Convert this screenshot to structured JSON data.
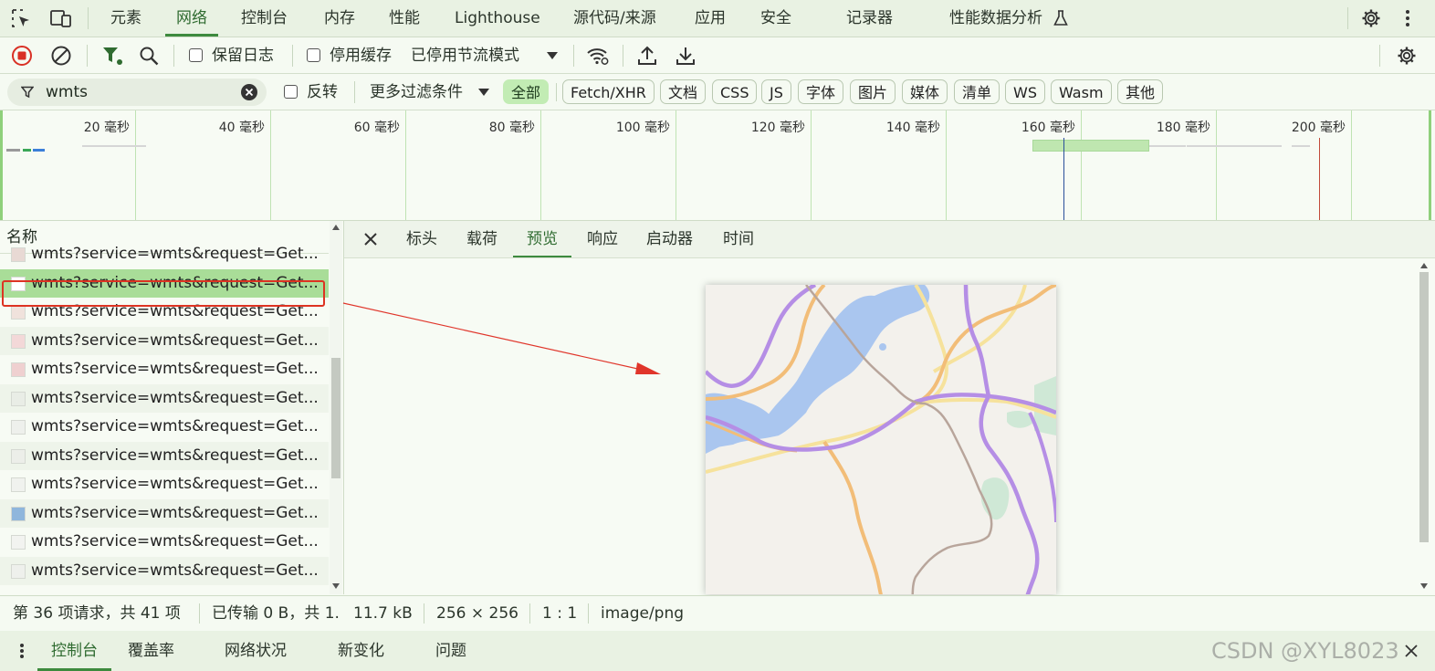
{
  "topbar": {
    "tabs": [
      {
        "label": "元素"
      },
      {
        "label": "网络"
      },
      {
        "label": "控制台"
      },
      {
        "label": "内存"
      },
      {
        "label": "性能"
      },
      {
        "label": "Lighthouse"
      },
      {
        "label": "源代码/来源"
      },
      {
        "label": "应用"
      },
      {
        "label": "安全"
      },
      {
        "label": "记录器"
      },
      {
        "label": "性能数据分析"
      }
    ],
    "active_tab": "网络"
  },
  "toolbar": {
    "preserve_log_label": "保留日志",
    "disable_cache_label": "停用缓存",
    "throttling_value": "已停用节流模式"
  },
  "filter": {
    "value": "wmts",
    "invert_label": "反转",
    "more_filters_label": "更多过滤条件",
    "types": [
      "全部",
      "Fetch/XHR",
      "文档",
      "CSS",
      "JS",
      "字体",
      "图片",
      "媒体",
      "清单",
      "WS",
      "Wasm",
      "其他"
    ],
    "active_type": "全部"
  },
  "overview": {
    "ticks": [
      "20 毫秒",
      "40 毫秒",
      "60 毫秒",
      "80 毫秒",
      "100 毫秒",
      "120 毫秒",
      "140 毫秒",
      "160 毫秒",
      "180 毫秒",
      "200 毫秒"
    ]
  },
  "request_list": {
    "header": "名称",
    "rows": [
      {
        "name": "wmts?service=wmts&request=Get..."
      },
      {
        "name": "wmts?service=wmts&request=Get...",
        "selected": true
      },
      {
        "name": "wmts?service=wmts&request=Get..."
      },
      {
        "name": "wmts?service=wmts&request=Get..."
      },
      {
        "name": "wmts?service=wmts&request=Get..."
      },
      {
        "name": "wmts?service=wmts&request=Get..."
      },
      {
        "name": "wmts?service=wmts&request=Get..."
      },
      {
        "name": "wmts?service=wmts&request=Get..."
      },
      {
        "name": "wmts?service=wmts&request=Get..."
      },
      {
        "name": "wmts?service=wmts&request=Get..."
      },
      {
        "name": "wmts?service=wmts&request=Get..."
      },
      {
        "name": "wmts?service=wmts&request=Get..."
      }
    ]
  },
  "detail": {
    "tabs": [
      "标头",
      "载荷",
      "预览",
      "响应",
      "启动器",
      "时间"
    ],
    "active_tab": "预览"
  },
  "statusbar": {
    "request_count": "第 36 项请求，共 41 项",
    "transferred": "已传输 0 B，共 1.",
    "size": "11.7 kB",
    "dimensions": "256 × 256",
    "ratio": "1 : 1",
    "mime": "image/png"
  },
  "drawer": {
    "tabs": [
      "控制台",
      "覆盖率",
      "网络状况",
      "新变化",
      "问题"
    ],
    "active_tab": "控制台",
    "watermark": "CSDN @XYL8023"
  },
  "colors": {
    "accent": "#3d8a3e",
    "record_red": "#d93025",
    "selection_green": "#a9dd98",
    "annotation_red": "#dd3322"
  }
}
